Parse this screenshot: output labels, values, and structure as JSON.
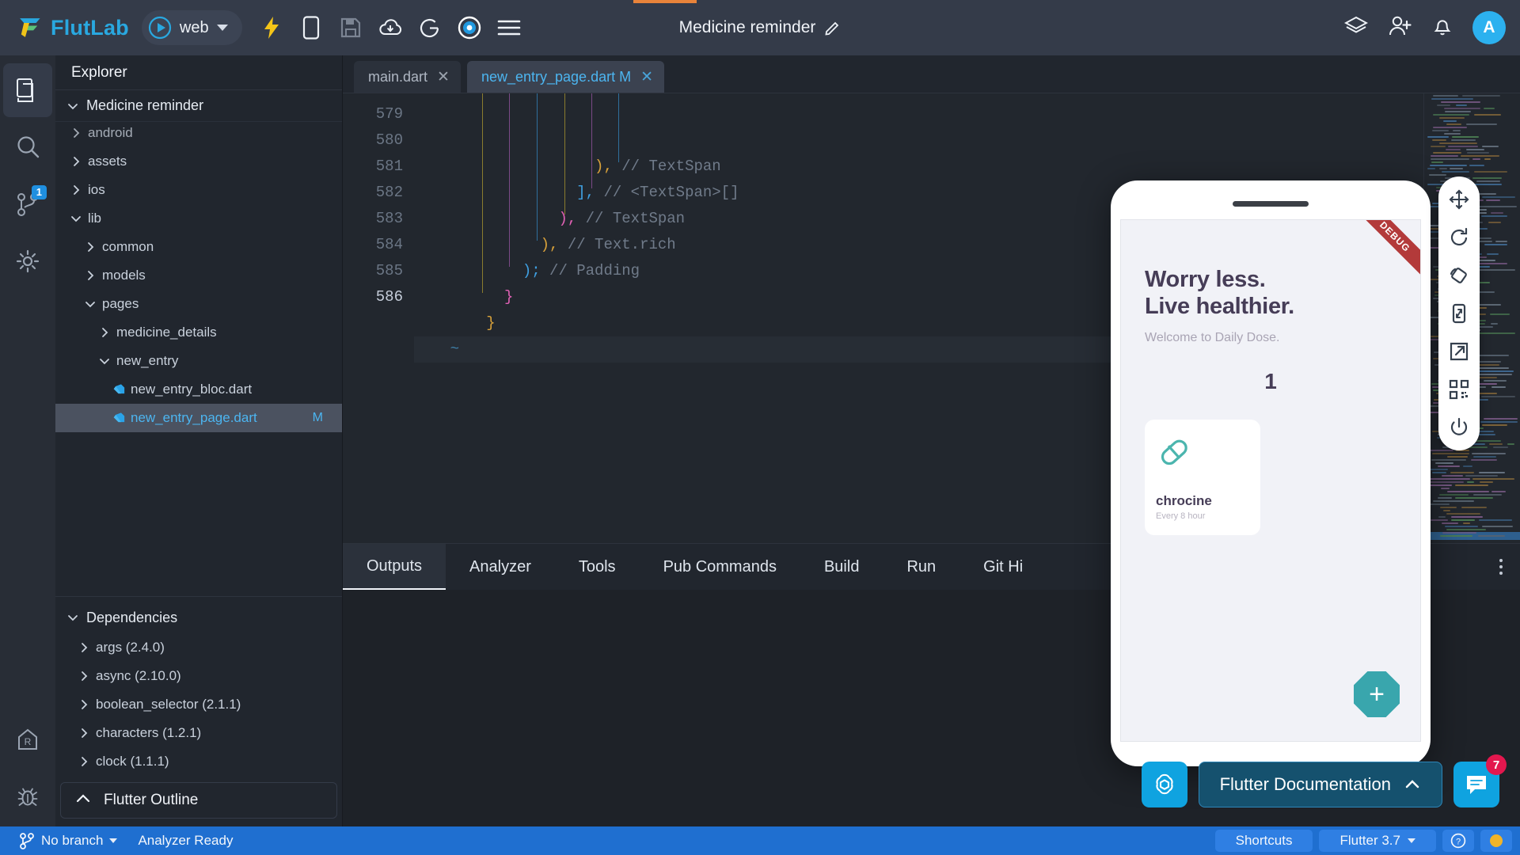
{
  "topbar": {
    "brand": "FlutLab",
    "target": "web",
    "doc_title": "Medicine reminder",
    "icons": [
      "lightning-icon",
      "mobile-icon",
      "save-icon",
      "cloud-download-icon",
      "google-icon",
      "settings-gear-icon",
      "hamburger-menu-icon"
    ],
    "right_icons": [
      "layers-icon",
      "add-user-icon",
      "notifications-bell-icon"
    ],
    "avatar_initial": "A"
  },
  "activitybar": {
    "top": [
      {
        "name": "files-icon",
        "active": true,
        "badge": null
      },
      {
        "name": "search-icon",
        "active": false,
        "badge": null
      },
      {
        "name": "git-branch-icon",
        "active": false,
        "badge": "1"
      },
      {
        "name": "settings-gear-icon",
        "active": false,
        "badge": null
      }
    ],
    "bottom": [
      {
        "name": "readme-icon",
        "active": false
      },
      {
        "name": "debug-bug-icon",
        "active": false
      }
    ]
  },
  "explorer": {
    "header": "Explorer",
    "project": "Medicine reminder",
    "tree": [
      {
        "label": "android",
        "depth": 0,
        "type": "folder",
        "state": "collapsed",
        "clipped": true
      },
      {
        "label": "assets",
        "depth": 0,
        "type": "folder",
        "state": "collapsed"
      },
      {
        "label": "ios",
        "depth": 0,
        "type": "folder",
        "state": "collapsed"
      },
      {
        "label": "lib",
        "depth": 0,
        "type": "folder",
        "state": "expanded"
      },
      {
        "label": "common",
        "depth": 1,
        "type": "folder",
        "state": "collapsed"
      },
      {
        "label": "models",
        "depth": 1,
        "type": "folder",
        "state": "collapsed"
      },
      {
        "label": "pages",
        "depth": 1,
        "type": "folder",
        "state": "expanded"
      },
      {
        "label": "medicine_details",
        "depth": 2,
        "type": "folder",
        "state": "collapsed"
      },
      {
        "label": "new_entry",
        "depth": 2,
        "type": "folder",
        "state": "expanded"
      },
      {
        "label": "new_entry_bloc.dart",
        "depth": 3,
        "type": "dart"
      },
      {
        "label": "new_entry_page.dart",
        "depth": 3,
        "type": "dart",
        "selected": true,
        "modified": "M"
      }
    ],
    "dependencies_header": "Dependencies",
    "dependencies": [
      "args (2.4.0)",
      "async (2.10.0)",
      "boolean_selector (2.1.1)",
      "characters (1.2.1)",
      "clock (1.1.1)"
    ],
    "outline_label": "Flutter Outline"
  },
  "editor": {
    "tabs": [
      {
        "label": "main.dart",
        "modified": "",
        "active": false
      },
      {
        "label": "new_entry_page.dart",
        "modified": "M",
        "active": true
      }
    ],
    "first_line_number": 579,
    "lines": [
      {
        "n": 579,
        "indent": 20,
        "code": ")",
        "punct_color": "#d8a13a",
        "tail": ",",
        "comment": "// TextSpan"
      },
      {
        "n": 580,
        "indent": 18,
        "code": "]",
        "punct_color": "#3f9fe0",
        "tail": ",",
        "comment": "// <TextSpan>[]"
      },
      {
        "n": 581,
        "indent": 16,
        "code": ")",
        "punct_color": "#e061b4",
        "tail": ",",
        "comment": "// TextSpan"
      },
      {
        "n": 582,
        "indent": 14,
        "code": ")",
        "punct_color": "#d8a13a",
        "tail": ",",
        "comment": "// Text.rich"
      },
      {
        "n": 583,
        "indent": 12,
        "code": ")",
        "punct_color": "#3f9fe0",
        "tail": ";",
        "comment": "// Padding"
      },
      {
        "n": 584,
        "indent": 10,
        "code": "}",
        "punct_color": "#e061b4",
        "tail": "",
        "comment": ""
      },
      {
        "n": 585,
        "indent": 8,
        "code": "}",
        "punct_color": "#d8a13a",
        "tail": "",
        "comment": ""
      },
      {
        "n": 586,
        "indent": 8,
        "code": "~",
        "punct_color": "#3f7fa8",
        "tail": "",
        "comment": "",
        "current": true
      }
    ]
  },
  "device": {
    "debug_ribbon": "DEBUG",
    "headline_line1": "Worry less.",
    "headline_line2": "Live healthier.",
    "subtitle": "Welcome to Daily Dose.",
    "counter": "1",
    "medicine": {
      "name": "chrocine",
      "frequency": "Every 8 hour",
      "icon": "pill-icon"
    },
    "fab_icon": "plus-icon",
    "toolbar_icons": [
      "move-icon",
      "reload-icon",
      "rotate-screen-icon",
      "resize-icon",
      "open-external-icon",
      "qr-code-icon",
      "power-icon"
    ]
  },
  "panel": {
    "tabs": [
      "Outputs",
      "Analyzer",
      "Tools",
      "Pub Commands",
      "Build",
      "Run",
      "Git Hi"
    ],
    "active_tab": "Outputs",
    "kebab": "more-options-icon"
  },
  "floating": {
    "openai_icon": "openai-icon",
    "documentation_label": "Flutter Documentation",
    "documentation_chevron": "chevron-up-icon",
    "chat_icon": "chat-icon",
    "chat_badge": "7"
  },
  "statusbar": {
    "branch": "No branch",
    "analyzer": "Analyzer Ready",
    "shortcuts": "Shortcuts",
    "flutter_version": "Flutter 3.7",
    "help_icon": "help-circle-icon",
    "status_dot_color": "#f0b429"
  },
  "colors": {
    "accent": "#29a8e0",
    "topbar_bg": "#343b49",
    "editor_bg": "#22272e",
    "statusbar_bg": "#1f6fd0",
    "selected_file": "#4cb5f0",
    "debug_red": "#b33a3a",
    "teal": "#39a6ad",
    "badge_red": "#e3174e"
  }
}
